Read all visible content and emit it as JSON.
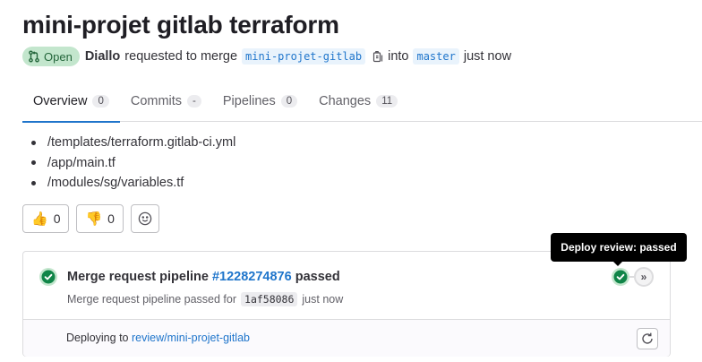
{
  "mr": {
    "title": "mini-projet gitlab terraform",
    "status_label": "Open",
    "author": "Diallo",
    "requested_text": "requested to merge",
    "source_branch": "mini-projet-gitlab",
    "into_text": "into",
    "target_branch": "master",
    "time": "just now"
  },
  "tabs": [
    {
      "label": "Overview",
      "count": "0"
    },
    {
      "label": "Commits",
      "count": "-"
    },
    {
      "label": "Pipelines",
      "count": "0"
    },
    {
      "label": "Changes",
      "count": "11"
    }
  ],
  "description": {
    "files": [
      "/templates/terraform.gitlab-ci.yml",
      "/app/main.tf",
      "/modules/sg/variables.tf"
    ]
  },
  "reactions": {
    "thumbs_up": {
      "icon": "👍",
      "count": "0"
    },
    "thumbs_down": {
      "icon": "👎",
      "count": "0"
    }
  },
  "pipeline": {
    "title_prefix": "Merge request pipeline",
    "id_link": "#1228274876",
    "status_text": "passed",
    "sub_prefix": "Merge request pipeline passed for",
    "sha": "1af58086",
    "time": "just now",
    "stage_tooltip": "Deploy review: passed",
    "deploy_prefix": "Deploying to",
    "environment": "review/mini-projet-gitlab"
  },
  "colors": {
    "success": "#108548",
    "link": "#1f75cb",
    "open_badge_bg": "#c3e6cd"
  }
}
